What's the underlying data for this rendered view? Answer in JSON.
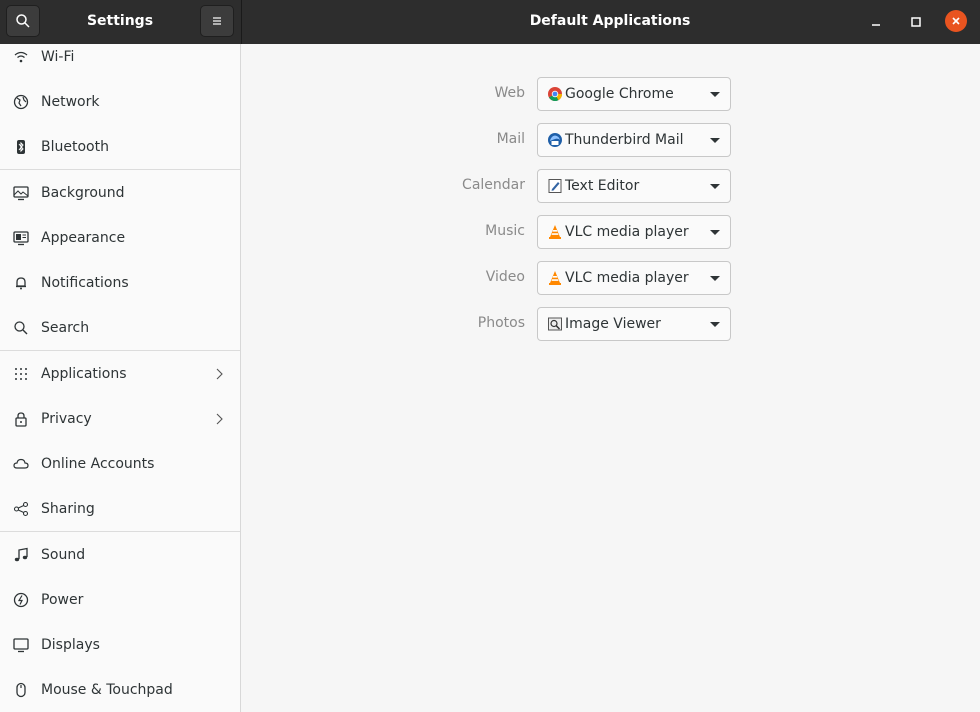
{
  "header": {
    "app_title": "Settings",
    "page_title": "Default Applications"
  },
  "sidebar": {
    "items": [
      {
        "label": "Wi-Fi",
        "icon": "wifi-icon"
      },
      {
        "label": "Network",
        "icon": "network-icon"
      },
      {
        "label": "Bluetooth",
        "icon": "bluetooth-icon"
      },
      {
        "label": "Background",
        "icon": "background-icon"
      },
      {
        "label": "Appearance",
        "icon": "appearance-icon"
      },
      {
        "label": "Notifications",
        "icon": "bell-icon"
      },
      {
        "label": "Search",
        "icon": "search-icon"
      },
      {
        "label": "Applications",
        "icon": "apps-grid-icon"
      },
      {
        "label": "Privacy",
        "icon": "lock-icon"
      },
      {
        "label": "Online Accounts",
        "icon": "cloud-icon"
      },
      {
        "label": "Sharing",
        "icon": "share-icon"
      },
      {
        "label": "Sound",
        "icon": "music-note-icon"
      },
      {
        "label": "Power",
        "icon": "power-icon"
      },
      {
        "label": "Displays",
        "icon": "display-icon"
      },
      {
        "label": "Mouse & Touchpad",
        "icon": "mouse-icon"
      }
    ]
  },
  "defaults": [
    {
      "label": "Web",
      "value": "Google Chrome",
      "icon": "chrome-icon"
    },
    {
      "label": "Mail",
      "value": "Thunderbird Mail",
      "icon": "thunderbird-icon"
    },
    {
      "label": "Calendar",
      "value": "Text Editor",
      "icon": "text-editor-icon"
    },
    {
      "label": "Music",
      "value": "VLC media player",
      "icon": "vlc-icon"
    },
    {
      "label": "Video",
      "value": "VLC media player",
      "icon": "vlc-icon"
    },
    {
      "label": "Photos",
      "value": "Image Viewer",
      "icon": "image-viewer-icon"
    }
  ],
  "colors": {
    "headerbar": "#2d2d2d",
    "close_button": "#e95420",
    "sidebar_bg": "#fafafa",
    "content_bg": "#f6f6f6"
  }
}
